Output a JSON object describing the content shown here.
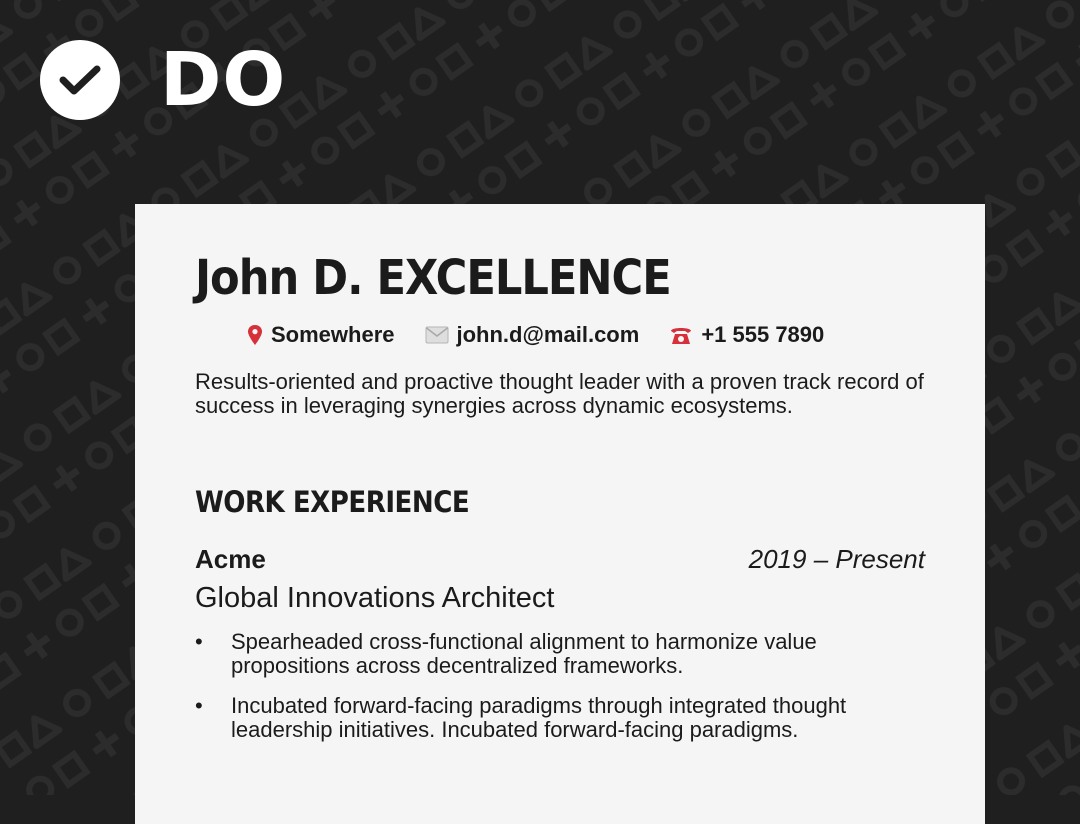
{
  "badge": {
    "label": "DO",
    "icon": "check-circle-icon"
  },
  "resume": {
    "name": "John D. EXCELLENCE",
    "contact": [
      {
        "icon": "location-pin-icon",
        "text": "Somewhere"
      },
      {
        "icon": "envelope-icon",
        "text": "john.d@mail.com"
      },
      {
        "icon": "telephone-icon",
        "text": "+1 555 7890"
      }
    ],
    "summary": "Results-oriented and proactive thought leader with a proven track record of success in leveraging synergies across dynamic ecosystems.",
    "section_title": "WORK EXPERIENCE",
    "job": {
      "company": "Acme",
      "dates": "2019 – Present",
      "title": "Global Innovations Architect",
      "bullets": [
        "Spearheaded cross-functional alignment to harmonize value propositions across decentralized frameworks.",
        "Incubated forward-facing paradigms through integrated thought leadership initiatives. Incubated forward-facing paradigms."
      ]
    }
  },
  "colors": {
    "background": "#1f1f1f",
    "paper": "#f5f5f5",
    "text": "#1b1b1b",
    "pin": "#d6303a",
    "phone": "#d6303a",
    "envelope": "#c9c9c9"
  }
}
